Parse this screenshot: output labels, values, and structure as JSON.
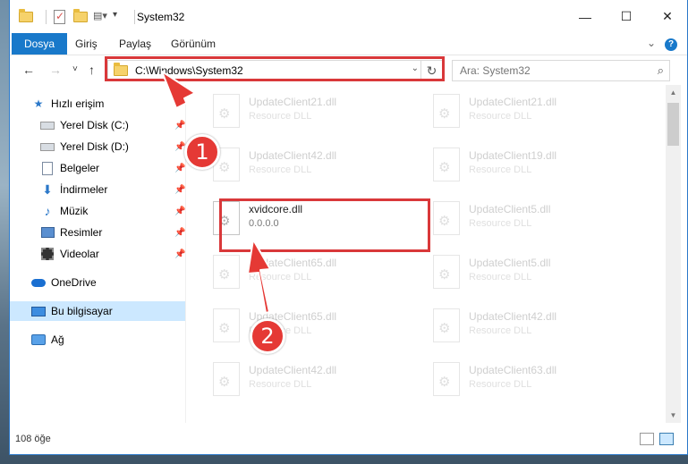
{
  "window": {
    "title": "System32",
    "controls": {
      "minimize": "—",
      "maximize": "☐",
      "close": "✕"
    }
  },
  "ribbon": {
    "tabs": [
      "Dosya",
      "Giriş",
      "Paylaş",
      "Görünüm"
    ],
    "expand_icon": "chevron-down-icon",
    "help_label": "?"
  },
  "nav": {
    "back": "←",
    "forward": "→",
    "recent": "˅",
    "up": "↑",
    "address": "C:\\Windows\\System32",
    "refresh": "↻",
    "search_placeholder": "Ara: System32"
  },
  "sidebar": {
    "items": [
      {
        "label": "Hızlı erişim",
        "icon": "star-icon",
        "pinned": false
      },
      {
        "label": "Yerel Disk (C:)",
        "icon": "drive-icon",
        "pinned": true
      },
      {
        "label": "Yerel Disk (D:)",
        "icon": "drive-icon",
        "pinned": true
      },
      {
        "label": "Belgeler",
        "icon": "documents-icon",
        "pinned": true
      },
      {
        "label": "İndirmeler",
        "icon": "download-icon",
        "pinned": true
      },
      {
        "label": "Müzik",
        "icon": "music-icon",
        "pinned": true
      },
      {
        "label": "Resimler",
        "icon": "pictures-icon",
        "pinned": true
      },
      {
        "label": "Videolar",
        "icon": "videos-icon",
        "pinned": true
      },
      {
        "label": "OneDrive",
        "icon": "cloud-icon",
        "pinned": false
      },
      {
        "label": "Bu bilgisayar",
        "icon": "computer-icon",
        "pinned": false,
        "selected": true
      },
      {
        "label": "Ağ",
        "icon": "network-icon",
        "pinned": false
      }
    ]
  },
  "files": {
    "left_column": [
      {
        "name": "UpdateClient21.dll",
        "sub": "Resource DLL",
        "faded": true
      },
      {
        "name": "UpdateClient42.dll",
        "sub": "Resource DLL",
        "faded": true
      },
      {
        "name": "xvidcore.dll",
        "sub": "0.0.0.0",
        "faded": false,
        "highlighted": true
      },
      {
        "name": "UpdateClient65.dll",
        "sub": "Resource DLL",
        "faded": true
      },
      {
        "name": "UpdateClient65.dll",
        "sub": "Resource DLL",
        "faded": true
      },
      {
        "name": "UpdateClient42.dll",
        "sub": "Resource DLL",
        "faded": true
      }
    ],
    "right_column": [
      {
        "name": "UpdateClient21.dll",
        "sub": "Resource DLL",
        "faded": true
      },
      {
        "name": "UpdateClient19.dll",
        "sub": "Resource DLL",
        "faded": true
      },
      {
        "name": "UpdateClient5.dll",
        "sub": "Resource DLL",
        "faded": true
      },
      {
        "name": "UpdateClient5.dll",
        "sub": "Resource DLL",
        "faded": true
      },
      {
        "name": "UpdateClient42.dll",
        "sub": "Resource DLL",
        "faded": true
      },
      {
        "name": "UpdateClient63.dll",
        "sub": "Resource DLL",
        "faded": true
      }
    ]
  },
  "status": {
    "item_count": "108 öğe"
  },
  "annotations": {
    "step1": "1",
    "step2": "2",
    "color": "#e53935"
  }
}
